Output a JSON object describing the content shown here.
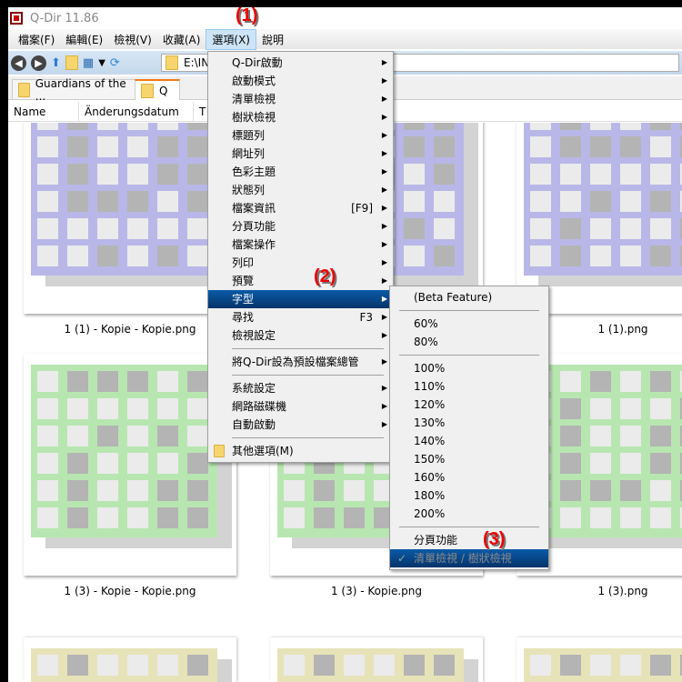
{
  "window": {
    "title": "Q-Dir 11.86"
  },
  "menubar": [
    "檔案(F)",
    "編輯(E)",
    "檢視(V)",
    "收藏(A)",
    "選項(X)",
    "說明"
  ],
  "address": "E:\\INI",
  "tabs": [
    "Guardians of the ...",
    "Q"
  ],
  "columns": [
    "Name",
    "Änderungsdatum",
    "T"
  ],
  "files": [
    {
      "name": "1 (1) - Kopie - Kopie.png",
      "color": "#b9b7e8"
    },
    {
      "name": "",
      "color": "#b9b7e8"
    },
    {
      "name": "1 (1).png",
      "color": "#b9b7e8"
    },
    {
      "name": "1 (3) - Kopie - Kopie.png",
      "color": "#b8e6b0"
    },
    {
      "name": "1 (3) - Kopie.png",
      "color": "#b8e6b0"
    },
    {
      "name": "1 (3).png",
      "color": "#b8e6b0"
    },
    {
      "name": "",
      "color": "#e6e3b8"
    },
    {
      "name": "",
      "color": "#e6e3b8"
    },
    {
      "name": "",
      "color": "#e6e3b8"
    }
  ],
  "options_menu": [
    {
      "label": "Q-Dir啟動",
      "arrow": true
    },
    {
      "label": "啟動模式",
      "arrow": true
    },
    {
      "label": "清單檢視",
      "arrow": true
    },
    {
      "label": "樹狀檢視",
      "arrow": true
    },
    {
      "label": "標題列",
      "arrow": true
    },
    {
      "label": "網址列",
      "arrow": true
    },
    {
      "label": "色彩主題",
      "arrow": true
    },
    {
      "label": "狀態列",
      "arrow": true
    },
    {
      "label": "檔案資訊",
      "shortcut": "[F9]",
      "arrow": true
    },
    {
      "label": "分頁功能",
      "arrow": true
    },
    {
      "label": "檔案操作",
      "arrow": true
    },
    {
      "label": "列印",
      "arrow": true
    },
    {
      "label": "預覽",
      "arrow": true
    },
    {
      "label": "字型",
      "arrow": true,
      "highlighted": true
    },
    {
      "label": "尋找",
      "shortcut": "F3",
      "arrow": true
    },
    {
      "label": "檢視設定",
      "arrow": true
    },
    {
      "sep": true
    },
    {
      "label": "將Q-Dir設為預設檔案總管",
      "arrow": true
    },
    {
      "sep": true
    },
    {
      "label": "系統設定",
      "arrow": true
    },
    {
      "label": "網路磁碟機",
      "arrow": true
    },
    {
      "label": "自動啟動",
      "arrow": true
    },
    {
      "sep": true
    },
    {
      "label": "其他選項(M)",
      "icon": "folder"
    }
  ],
  "font_submenu": [
    {
      "label": "(Beta Feature)"
    },
    {
      "sep": true
    },
    {
      "label": "60%"
    },
    {
      "label": "80%"
    },
    {
      "sep": true
    },
    {
      "label": "100%"
    },
    {
      "label": "110%"
    },
    {
      "label": "120%"
    },
    {
      "label": "130%"
    },
    {
      "label": "140%"
    },
    {
      "label": "150%"
    },
    {
      "label": "160%"
    },
    {
      "label": "180%"
    },
    {
      "label": "200%"
    },
    {
      "sep": true
    },
    {
      "label": "分頁功能"
    },
    {
      "label": "清單檢視 / 樹狀檢視",
      "checked": true,
      "highlighted": true,
      "disabled": true
    }
  ],
  "annotations": [
    "(1)",
    "(2)",
    "(3)"
  ]
}
